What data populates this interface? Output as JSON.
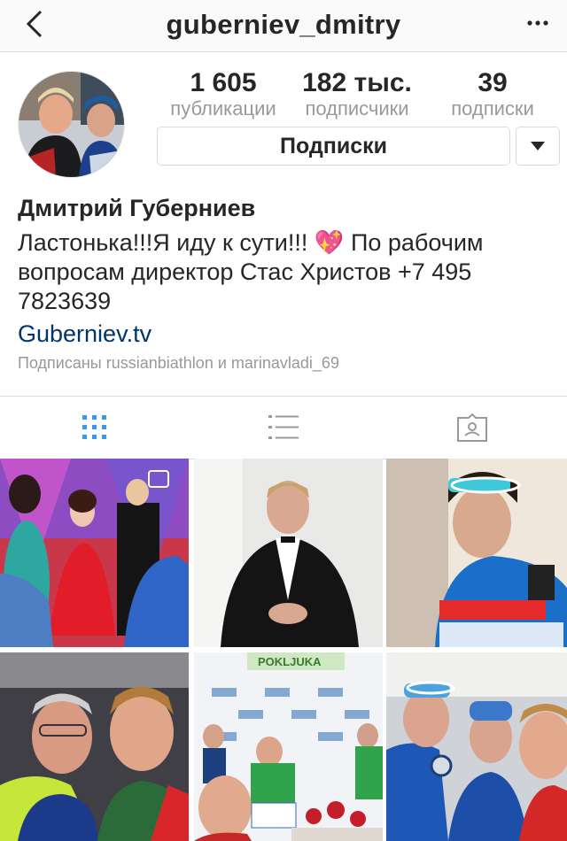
{
  "header": {
    "username": "guberniev_dmitry",
    "back_icon": "chevron-left-icon",
    "more_icon": "more-dots-icon"
  },
  "profile": {
    "stats": [
      {
        "value": "1 605",
        "label": "публикации"
      },
      {
        "value": "182 тыс.",
        "label": "подписчики"
      },
      {
        "value": "39",
        "label": "подписки"
      }
    ],
    "subscribe_label": "Подписки",
    "dropdown_icon": "caret-down-icon",
    "name": "Дмитрий Губерниев",
    "bio_line1": "Ластонька!!!Я иду к сути!!! 💖  По рабочим",
    "bio_line2": "вопросам директор Стас Христов +7 495",
    "bio_line3": "7823639",
    "website": "Guberniev.tv",
    "followed_by": "Подписаны russianbiathlon и marinavladi_69"
  },
  "tabs": [
    {
      "name": "grid-view",
      "icon": "grid-icon",
      "active": true
    },
    {
      "name": "list-view",
      "icon": "list-icon",
      "active": false
    },
    {
      "name": "tagged",
      "icon": "tagged-photo-icon",
      "active": false
    }
  ],
  "colors": {
    "active_tab": "#3897f0",
    "inactive_icon": "#999999",
    "link": "#003569",
    "border": "#dbdbdb"
  },
  "posts_count_visible": 6,
  "banner_text": "POKLJUKA"
}
